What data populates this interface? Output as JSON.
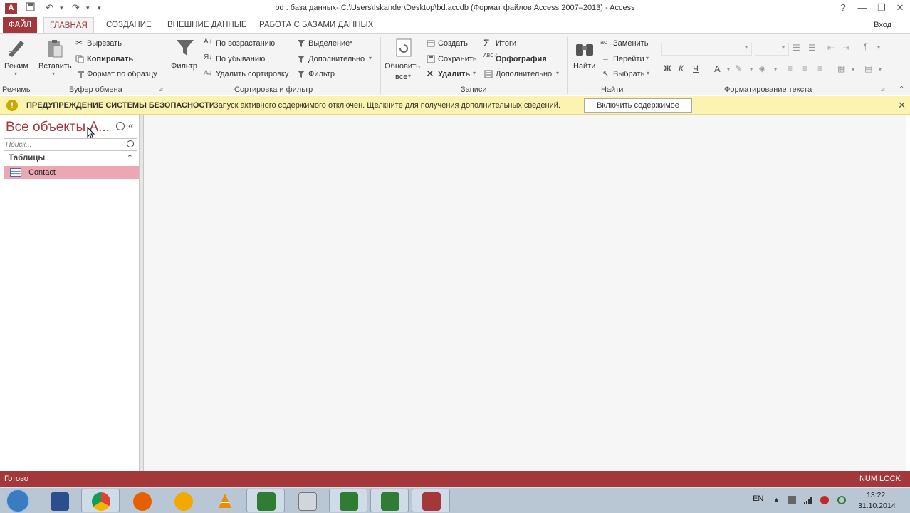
{
  "titlebar": {
    "app_icon": "A",
    "title": "bd : база данных- C:\\Users\\Iskander\\Desktop\\bd.accdb (Формат файлов Access 2007–2013) - Access",
    "help": "?",
    "minimize": "—",
    "restore": "❐",
    "close": "✕"
  },
  "tabs": [
    "ФАЙЛ",
    "ГЛАВНАЯ",
    "СОЗДАНИЕ",
    "ВНЕШНИЕ ДАННЫЕ",
    "РАБОТА С БАЗАМИ ДАННЫХ"
  ],
  "login": "Вход",
  "ribbon": {
    "views": {
      "mode": "Режим",
      "group": "Режимы"
    },
    "clipboard": {
      "paste": "Вставить",
      "cut": "Вырезать",
      "copy": "Копировать",
      "format_painter": "Формат по образцу",
      "group": "Буфер обмена"
    },
    "sort_filter": {
      "filter": "Фильтр",
      "ascending": "По возрастанию",
      "descending": "По убыванию",
      "remove_sort": "Удалить сортировку",
      "selection": "Выделение",
      "advanced": "Дополнительно",
      "toggle_filter": "Фильтр",
      "group": "Сортировка и фильтр"
    },
    "records": {
      "refresh_line1": "Обновить",
      "refresh_line2": "все",
      "new": "Создать",
      "save": "Сохранить",
      "delete": "Удалить",
      "totals": "Итоги",
      "spelling": "Орфография",
      "more": "Дополнительно",
      "group": "Записи"
    },
    "find": {
      "find": "Найти",
      "replace": "Заменить",
      "goto": "Перейти",
      "select": "Выбрать",
      "group": "Найти"
    },
    "text_format": {
      "bold": "Ж",
      "italic": "К",
      "underline": "Ч",
      "font_color": "A",
      "group": "Форматирование текста"
    }
  },
  "security_bar": {
    "icon": "!",
    "title": "ПРЕДУПРЕЖДЕНИЕ СИСТЕМЫ БЕЗОПАСНОСТИ",
    "message": "Запуск активного содержимого отключен. Щелкните для получения дополнительных сведений.",
    "button": "Включить содержимое",
    "close": "✕"
  },
  "nav": {
    "title": "Все объекты А...",
    "collapse": "«",
    "search_placeholder": "Поиск...",
    "group_label": "Таблицы",
    "group_toggle": "⌃",
    "items": [
      {
        "label": "Contact"
      }
    ]
  },
  "status": {
    "left": "Готово",
    "right": "NUM LOCK"
  },
  "taskbar": {
    "lang": "EN",
    "time": "13:22",
    "date": "31.10.2014"
  }
}
